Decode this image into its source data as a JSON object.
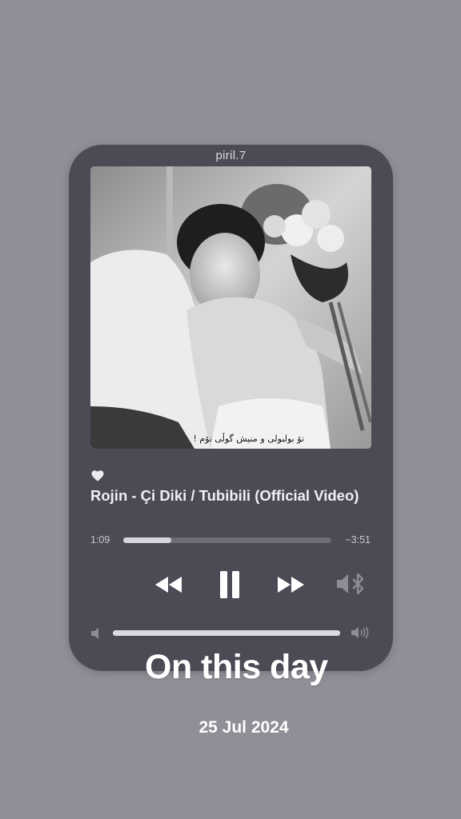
{
  "card": {
    "username": "piril.7",
    "artwork_caption": "تۆ بولبولی و منیش گوڵی تۆم !",
    "song_title": "Rojin - Çi Diki / Tubibili (Official Video)",
    "liked": true,
    "playback": {
      "elapsed": "1:09",
      "remaining": "−3:51",
      "progress": 0.23
    },
    "volume": {
      "level": 1.0
    },
    "controls": {
      "rewind": "rewind-icon",
      "pause": "pause-icon",
      "forward": "fast-forward-icon",
      "output": "bluetooth-speaker-icon"
    }
  },
  "overlay": {
    "title": "On this day",
    "date": "25 Jul 2024"
  },
  "colors": {
    "background": "#908e96",
    "card": "#4c4a55",
    "text": "#f0eff3"
  }
}
